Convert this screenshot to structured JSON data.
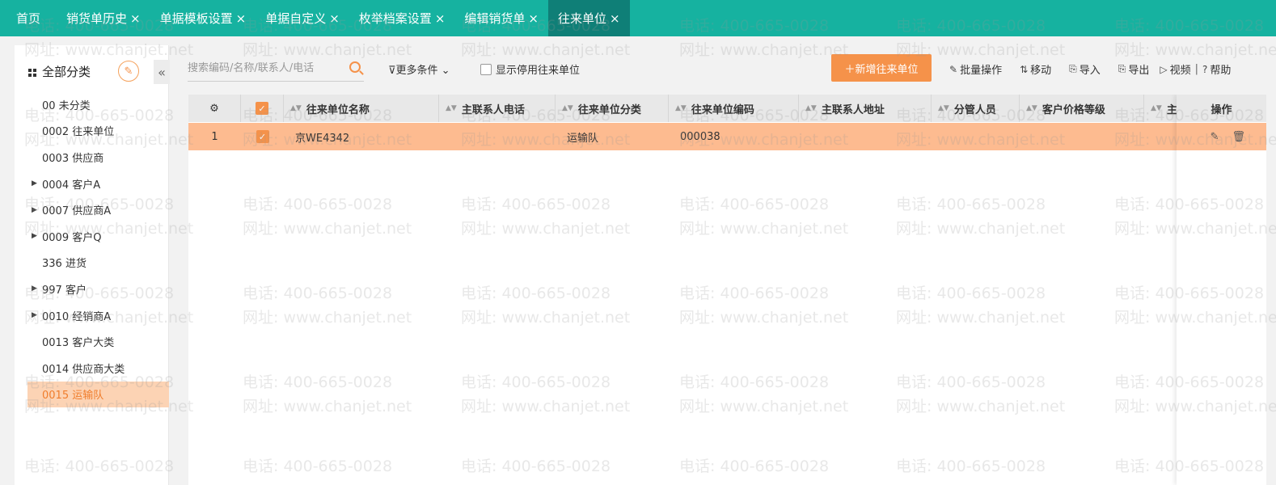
{
  "tabs": [
    {
      "label": "首页",
      "closable": false
    },
    {
      "label": "销货单历史",
      "closable": true
    },
    {
      "label": "单据模板设置",
      "closable": true
    },
    {
      "label": "单据自定义",
      "closable": true
    },
    {
      "label": "枚举档案设置",
      "closable": true
    },
    {
      "label": "编辑销货单",
      "closable": true
    },
    {
      "label": "往来单位",
      "closable": true,
      "active": true
    }
  ],
  "close_glyph": "×",
  "sidebar": {
    "title": "全部分类",
    "edit_icon": "edit-icon",
    "collapse_glyph": "«",
    "categories": [
      {
        "label": "00 未分类",
        "expandable": false
      },
      {
        "label": "0002 往来单位",
        "expandable": false
      },
      {
        "label": "0003 供应商",
        "expandable": false
      },
      {
        "label": "0004 客户A",
        "expandable": true
      },
      {
        "label": "0007 供应商A",
        "expandable": true
      },
      {
        "label": "0009 客户Q",
        "expandable": true
      },
      {
        "label": "336 进货",
        "expandable": false
      },
      {
        "label": "997 客户",
        "expandable": true
      },
      {
        "label": "0010 经销商A",
        "expandable": true
      },
      {
        "label": "0013 客户大类",
        "expandable": false
      },
      {
        "label": "0014 供应商大类",
        "expandable": false
      },
      {
        "label": "0015 运输队",
        "expandable": false,
        "selected": true
      }
    ]
  },
  "toolbar": {
    "search_placeholder": "搜索编码/名称/联系人/电话",
    "more_conditions": "更多条件",
    "show_disabled": "显示停用往来单位",
    "add_button": "新增往来单位",
    "batch": "批量操作",
    "move": "移动",
    "import": "导入",
    "export": "导出",
    "video": "视频",
    "divider": "|",
    "help": "帮助"
  },
  "table": {
    "columns": [
      "往来单位名称",
      "主联系人电话",
      "往来单位分类",
      "往来单位编码",
      "主联系人地址",
      "分管人员",
      "客户价格等级",
      "主"
    ],
    "operation_header": "操作",
    "rows": [
      {
        "index": "1",
        "checked": true,
        "name": "京WE4342",
        "phone": "",
        "category": "运输队",
        "code": "000038",
        "address": "",
        "manager": "",
        "price_level": ""
      }
    ]
  },
  "watermark": {
    "phone": "电话: 400-665-0028",
    "site": "网址: www.chanjet.net"
  },
  "colors": {
    "teal": "#16b2a0",
    "teal_active": "#0f7f77",
    "orange": "#f5924a",
    "row_highlight": "#fdbb90"
  }
}
